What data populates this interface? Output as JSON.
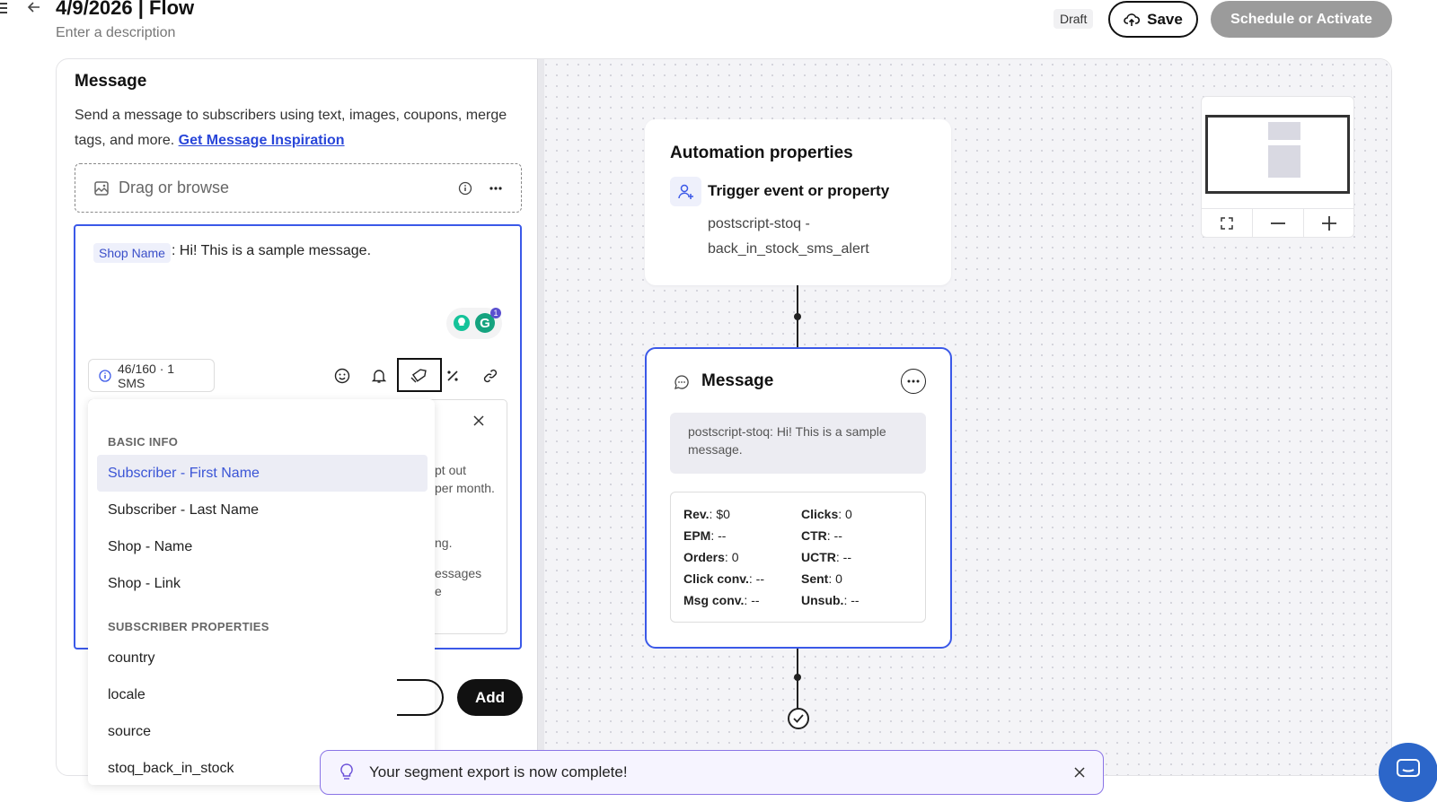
{
  "header": {
    "title": "4/9/2026 | Flow",
    "description_placeholder": "Enter a description",
    "status": "Draft",
    "save_label": "Save",
    "schedule_label": "Schedule or Activate"
  },
  "panel": {
    "title": "Message",
    "description": "Send a message to subscribers using text, images, coupons, merge tags, and more.",
    "inspiration_link": "Get Message Inspiration",
    "drag_label": "Drag or browse"
  },
  "editor": {
    "merge_chip": "Shop Name",
    "message": ": Hi! This is a sample message.",
    "char_count": "46/160 · 1 SMS",
    "grammarly_badge": "1"
  },
  "behind_card": {
    "line1": "pt out",
    "line2": "per month.",
    "line3": "ng.",
    "line4": "essages",
    "line5": "e"
  },
  "merge_dropdown": {
    "section_basic": "BASIC INFO",
    "basic_items": [
      "Subscriber - First Name",
      "Subscriber - Last Name",
      "Shop - Name",
      "Shop - Link"
    ],
    "section_props": "SUBSCRIBER PROPERTIES",
    "prop_items": [
      "country",
      "locale",
      "source",
      "stoq_back_in_stock"
    ]
  },
  "actions": {
    "add_label": "Add"
  },
  "automation": {
    "title": "Automation properties",
    "trigger_label": "Trigger event or property",
    "trigger_value": "postscript-stoq - back_in_stock_sms_alert"
  },
  "message_node": {
    "title": "Message",
    "preview": "postscript-stoq: Hi! This is a sample message.",
    "stats": {
      "rev_label": "Rev.",
      "rev_value": ": $0",
      "epm_label": "EPM",
      "epm_value": ": --",
      "orders_label": "Orders",
      "orders_value": ": 0",
      "clickconv_label": "Click conv.",
      "clickconv_value": ": --",
      "msgconv_label": "Msg conv.",
      "msgconv_value": ": --",
      "clicks_label": "Clicks",
      "clicks_value": ": 0",
      "ctr_label": "CTR",
      "ctr_value": ": --",
      "uctr_label": "UCTR",
      "uctr_value": ": --",
      "sent_label": "Sent",
      "sent_value": ": 0",
      "unsub_label": "Unsub.",
      "unsub_value": ": --"
    }
  },
  "toast": {
    "text": "Your segment export is now complete!"
  },
  "colors": {
    "accent": "#3b59e8",
    "link": "#2946d9",
    "toast_border": "#8a74e6",
    "chat_fab": "#2c66c9"
  }
}
